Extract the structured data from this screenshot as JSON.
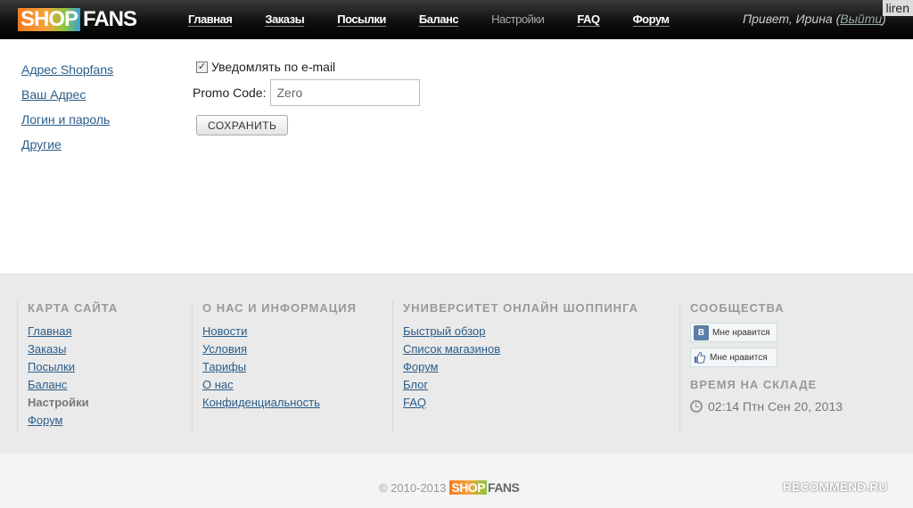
{
  "header": {
    "logo": {
      "shop": "SHOP",
      "fans": "FANS"
    },
    "nav": [
      {
        "label": "Главная",
        "active": false
      },
      {
        "label": "Заказы",
        "active": false
      },
      {
        "label": "Посылки",
        "active": false
      },
      {
        "label": "Баланс",
        "active": false
      },
      {
        "label": "Настройки",
        "active": true
      },
      {
        "label": "FAQ",
        "active": false
      },
      {
        "label": "Форум",
        "active": false
      }
    ],
    "greeting": "Привет, Ирина (",
    "logout": "Выйти",
    "greeting_close": ")",
    "corner_tag": "liren"
  },
  "sidebar": {
    "items": [
      {
        "label": "Адрес Shopfans"
      },
      {
        "label": "Ваш Адрес"
      },
      {
        "label": "Логин и пароль"
      },
      {
        "label": "Другие"
      }
    ]
  },
  "form": {
    "notify_checked": true,
    "notify_label": "Уведомлять по e-mail",
    "promo_label": "Promo Code:",
    "promo_value": "Zero",
    "save_label": "СОХРАНИТЬ"
  },
  "footer": {
    "sitemap": {
      "title": "КАРТА САЙТА",
      "links": [
        "Главная",
        "Заказы",
        "Посылки",
        "Баланс",
        "Настройки",
        "Форум"
      ],
      "current_index": 4
    },
    "about": {
      "title": "О НАС И ИНФОРМАЦИЯ",
      "links": [
        "Новости",
        "Условия",
        "Тарифы",
        "О нас",
        "Конфиденциальность"
      ]
    },
    "university": {
      "title": "УНИВЕРСИТЕТ ОНЛАЙН ШОППИНГА",
      "links": [
        "Быстрый обзор",
        "Список магазинов",
        "Форум",
        "Блог",
        "FAQ"
      ]
    },
    "community": {
      "title": "СООБЩЕСТВА",
      "vk_like": "Мне нравится",
      "fb_like": "Мне нравится",
      "warehouse_title": "ВРЕМЯ НА СКЛАДЕ",
      "warehouse_time": "02:14 Птн Сен 20, 2013"
    }
  },
  "bottom": {
    "copyright": "© 2010-2013",
    "logo_shop": "SHOP",
    "logo_fans": "FANS",
    "watermark": "RECOMMEND.RU"
  }
}
